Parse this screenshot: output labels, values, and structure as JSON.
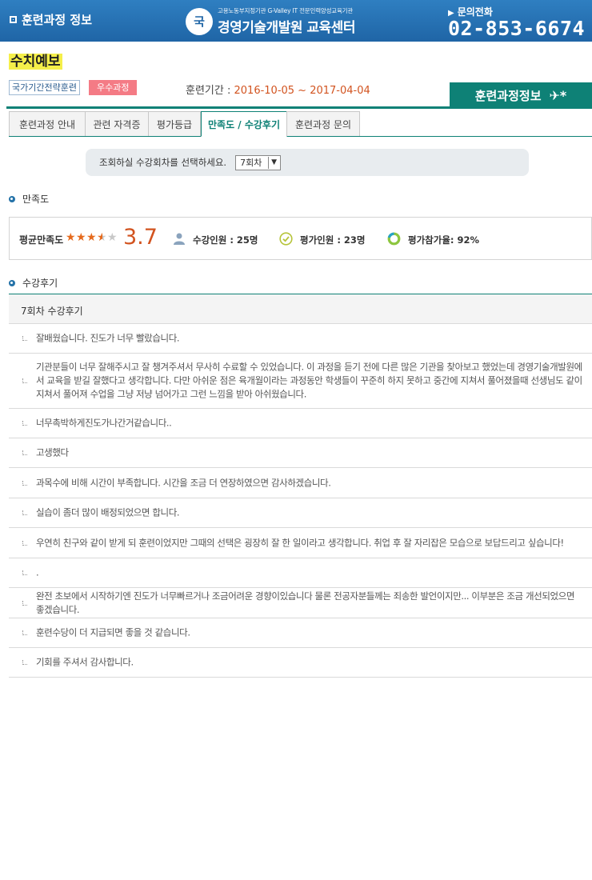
{
  "header": {
    "section_label": "훈련과정 정보",
    "org_sub": "고용노동부지정기관 G-Valley IT 전문인력양성교육기관",
    "org_name": "경영기술개발원 교육센터",
    "logo_mark": "\"국\"",
    "phone_label": "문의전화",
    "phone_number": "02-853-6674"
  },
  "course": {
    "name": "수치예보",
    "badge_national": "국가기간전략훈련",
    "badge_excellent": "우수과정",
    "period_label": "훈련기간 : ",
    "period_value": "2016-10-05 ~ 2017-04-04",
    "info_button": "훈련과정정보"
  },
  "tabs": [
    {
      "label": "훈련과정 안내"
    },
    {
      "label": "관련 자격증"
    },
    {
      "label": "평가등급"
    },
    {
      "label": "만족도 / 수강후기"
    },
    {
      "label": "훈련과정 문의"
    }
  ],
  "selector": {
    "prompt": "조회하실 수강회차를 선택하세요.",
    "selected": "7회차"
  },
  "satisfaction": {
    "heading": "만족도",
    "avg_label": "평균만족도",
    "rating": 3.7,
    "score": "3.7",
    "enrolled": "수강인원 : 25명",
    "evaluated": "평가인원 : 23명",
    "participation": "평가참가율: 92%"
  },
  "reviews": {
    "heading": "수강후기",
    "list_title": "7회차 수강후기",
    "items": [
      "잘배웠습니다. 진도가 너무 빨랐습니다.",
      "기관분들이 너무 잘해주시고 잘 챙겨주셔서 무사히 수료할 수 있었습니다. 이 과정을 듣기 전에 다른 많은 기관을 찾아보고 했었는데 경영기술개발원에서 교육을 받길 잘했다고 생각합니다. 다만 아쉬운 점은 육개월이라는 과정동안 학생들이 꾸준히 하지 못하고 중간에 지쳐서 풀어졌을때 선생님도 같이 지쳐서 풀어져 수업을 그냥 저냥 넘어가고 그런 느낌을 받아 아쉬웠습니다.",
      "너무촉박하게진도가나간거같습니다..",
      "고생했다",
      "과목수에 비해 시간이 부족합니다. 시간을 조금 더 연장하였으면 감사하겠습니다.",
      "실습이 좀더 많이 배정되었으면 합니다.",
      "우연히 친구와 같이 받게 되 훈련이었지만 그때의 선택은 굉장히 잘 한 일이라고 생각합니다. 취업 후 잘 자리잡은 모습으로 보답드리고 싶습니다!",
      ".",
      "완전 초보에서 시작하기엔 진도가 너무빠르거나 조금어려운 경향이있습니다 물론 전공자분들께는 죄송한 발언이지만... 이부분은 조금 개선되었으면 좋겠습니다.",
      "훈련수당이 더 지급되면 좋을 것 같습니다.",
      "기회를 주셔서 감사합니다."
    ]
  },
  "colors": {
    "header_blue": "#1f65a6",
    "teal": "#0e8176",
    "accent_orange": "#d2531f",
    "highlight_yellow": "#f5ef4a",
    "badge_pink": "#f47b85"
  },
  "icons": [
    "logo-mark-icon",
    "phone-arrow-icon",
    "sparkle-icon",
    "star-icon",
    "person-icon",
    "check-circle-icon",
    "ring-chart-icon",
    "section-dot-icon",
    "dropdown-arrow-icon"
  ]
}
